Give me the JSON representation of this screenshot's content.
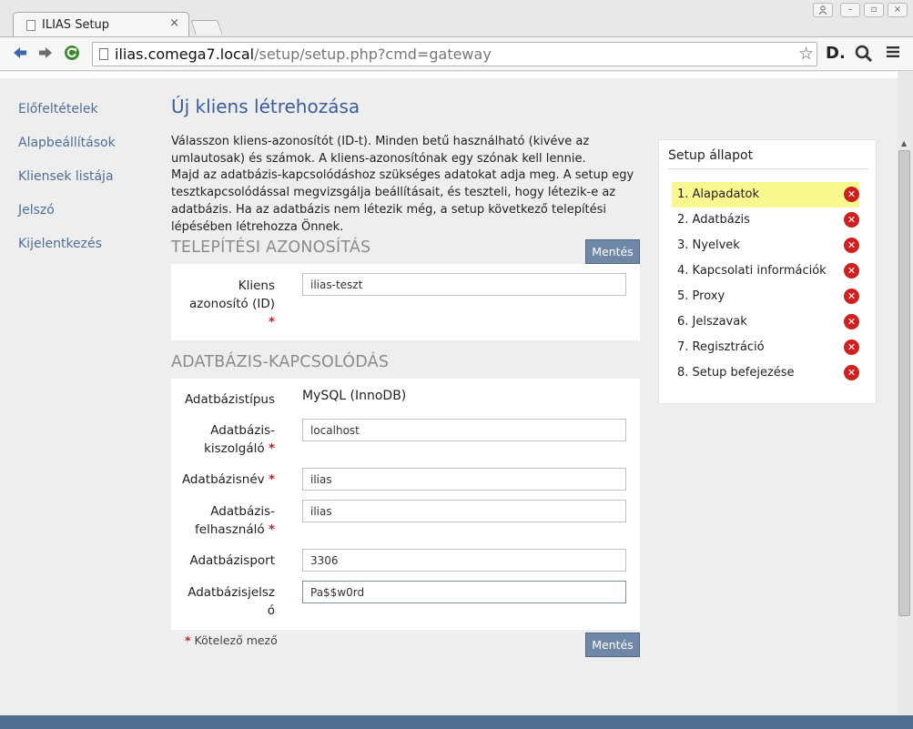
{
  "browser": {
    "tab_title": "ILIAS Setup",
    "tab_close": "×",
    "url_host": "ilias.comega7.local",
    "url_path": "/setup/setup.php?cmd=gateway"
  },
  "nav": [
    {
      "label": "Előfeltételek"
    },
    {
      "label": "Alapbeállítások"
    },
    {
      "label": "Kliensek listája"
    },
    {
      "label": "Jelszó"
    },
    {
      "label": "Kijelentkezés"
    }
  ],
  "main": {
    "title": "Új kliens létrehozása",
    "intro_1": "Válasszon kliens-azonosítót (ID-t). Minden betű használható (kivéve az umlautosak) és számok. A kliens-azonosítónak egy szónak kell lennie.",
    "intro_2": "Majd az adatbázis-kapcsolódáshoz szükséges adatokat adja meg. A setup egy tesztkapcsolódással megvizsgálja beállításait, és teszteli, hogy létezik-e az adatbázis. Ha az adatbázis nem létezik még, a setup következő telepítési lépésében létrehozza Önnek.",
    "section_install": "TELEPÍTÉSI AZONOSÍTÁS",
    "section_db": "ADATBÁZIS-KAPCSOLÓDÁS",
    "save_label": "Mentés",
    "required_marker": "*",
    "required_note": "Kötelező mező",
    "client_id": {
      "label_1": "Kliens",
      "label_2": "azonosító (ID)",
      "value": "ilias-teszt"
    },
    "db_type": {
      "label": "Adatbázistípus",
      "value": "MySQL (InnoDB)"
    },
    "db_host": {
      "label_1": "Adatbázis-",
      "label_2": "kiszolgáló",
      "value": "localhost"
    },
    "db_name": {
      "label": "Adatbázisnév",
      "value": "ilias"
    },
    "db_user": {
      "label_1": "Adatbázis-",
      "label_2": "felhasználó",
      "value": "ilias"
    },
    "db_port": {
      "label": "Adatbázisport",
      "value": "3306"
    },
    "db_pass": {
      "label_1": "Adatbázisjelsz",
      "label_2": "ó",
      "value": "Pa$$w0rd"
    }
  },
  "status": {
    "title": "Setup állapot",
    "icon_glyph": "✕",
    "items": [
      {
        "label": "1. Alapadatok",
        "current": true
      },
      {
        "label": "2. Adatbázis"
      },
      {
        "label": "3. Nyelvek"
      },
      {
        "label": "4. Kapcsolati információk"
      },
      {
        "label": "5. Proxy"
      },
      {
        "label": "6. Jelszavak"
      },
      {
        "label": "7. Regisztráció"
      },
      {
        "label": "8. Setup befejezése"
      }
    ]
  },
  "colors": {
    "accent": "#3b5d9c",
    "button": "#6f88a8",
    "status_error": "#cf1f1f",
    "current_step": "#fbf88f"
  },
  "icons": [
    "back-arrow-icon",
    "forward-arrow-icon",
    "reload-icon",
    "page-icon",
    "star-icon",
    "menu-icon",
    "error-x-icon"
  ]
}
